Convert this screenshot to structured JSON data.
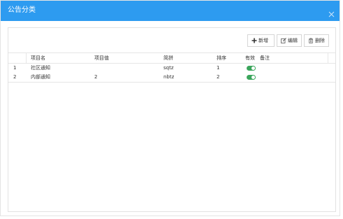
{
  "dialog": {
    "title": "公告分类",
    "close_icon": "close-icon"
  },
  "toolbar": {
    "add_label": "新增",
    "edit_label": "编辑",
    "delete_label": "删除",
    "add_icon": "plus-icon",
    "edit_icon": "edit-icon",
    "delete_icon": "trash-icon"
  },
  "table": {
    "columns": {
      "name": "项目名",
      "value": "项目值",
      "abbr": "简拼",
      "order": "排序",
      "valid": "有效",
      "note": "备注"
    },
    "rows": [
      {
        "index": "1",
        "name": "社区通知",
        "value": "",
        "abbr": "sqtz",
        "order": "1",
        "valid": true,
        "note": ""
      },
      {
        "index": "2",
        "name": "内部通知",
        "value": "2",
        "abbr": "nbtz",
        "order": "2",
        "valid": true,
        "note": ""
      }
    ]
  },
  "colors": {
    "titlebar": "#2d9bf0",
    "toggle_on": "#3ba55c",
    "border": "#e2e2e2"
  }
}
